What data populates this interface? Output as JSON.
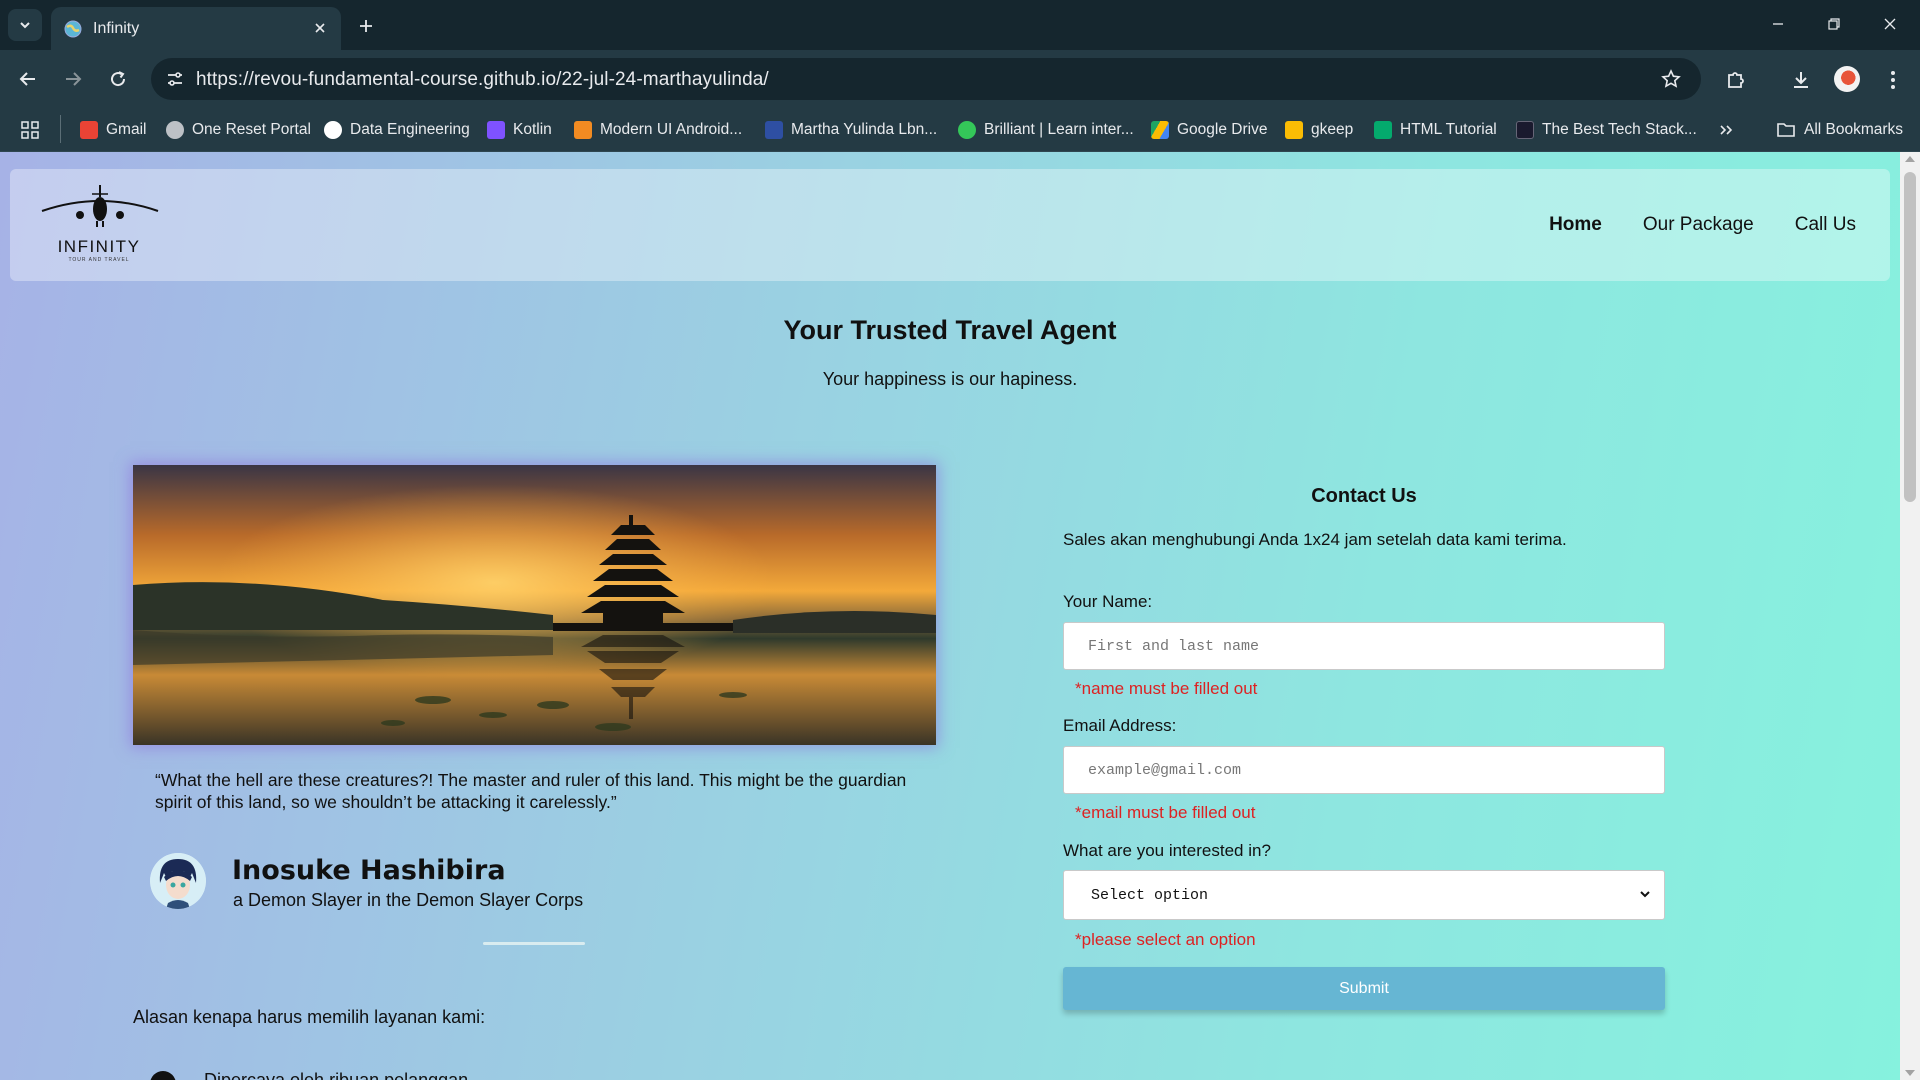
{
  "browser": {
    "tab_title": "Infinity",
    "url": "https://revou-fundamental-course.github.io/22-jul-24-marthayulinda/",
    "bookmarks": [
      {
        "label": "Gmail",
        "icon": "gmail-icon",
        "color": "#ea4335"
      },
      {
        "label": "One Reset Portal",
        "icon": "globe-icon",
        "color": "#bdc1c6"
      },
      {
        "label": "Data Engineering",
        "icon": "github-icon",
        "color": "#ffffff"
      },
      {
        "label": "Kotlin",
        "icon": "kotlin-icon",
        "color": "#7f52ff"
      },
      {
        "label": "Modern UI Android...",
        "icon": "bookmark-orange-icon",
        "color": "#f28b22"
      },
      {
        "label": "Martha Yulinda Lbn...",
        "icon": "del-icon",
        "color": "#2e4fa3"
      },
      {
        "label": "Brilliant | Learn inter...",
        "icon": "brilliant-icon",
        "color": "#34c759"
      },
      {
        "label": "Google Drive",
        "icon": "drive-icon",
        "color": "#fbbc04"
      },
      {
        "label": "gkeep",
        "icon": "keep-icon",
        "color": "#fbbc04"
      },
      {
        "label": "HTML Tutorial",
        "icon": "w3schools-icon",
        "color": "#04aa6d"
      },
      {
        "label": "The Best Tech Stack...",
        "icon": "techstack-icon",
        "color": "#1a1a2e"
      }
    ],
    "all_bookmarks_label": "All Bookmarks"
  },
  "site": {
    "logo_text": "INFINITY",
    "logo_subtext": "TOUR AND TRAVEL",
    "nav": [
      {
        "label": "Home",
        "active": true
      },
      {
        "label": "Our Package",
        "active": false
      },
      {
        "label": "Call Us",
        "active": false
      }
    ],
    "hero_title": "Your Trusted Travel Agent",
    "hero_subtitle": "Your happiness is our hapiness."
  },
  "testimonial": {
    "quote": "“What the hell are these creatures?! The master and ruler of this land. This might be the guardian spirit of this land, so we shouldn’t be attacking it carelessly.”",
    "name": "Inosuke Hashibira",
    "role": "a Demon Slayer in the Demon Slayer Corps"
  },
  "reasons": {
    "title": "Alasan kenapa harus memilih layanan kami:",
    "first_item": "Dipercaya oleh ribuan pelanggan"
  },
  "contact": {
    "title": "Contact Us",
    "description": "Sales akan menghubungi Anda 1x24 jam setelah data kami terima.",
    "name_label": "Your Name:",
    "name_placeholder": "First and last name",
    "name_error": "*name must be filled out",
    "email_label": "Email Address:",
    "email_placeholder": "example@gmail.com",
    "email_error": "*email must be filled out",
    "interest_label": "What are you interested in?",
    "interest_selected": "Select option",
    "interest_error": "*please select an option",
    "submit_label": "Submit"
  },
  "colors": {
    "error": "#dd2222",
    "submit": "#66b6d3",
    "chrome_dark": "#15262e",
    "chrome": "#243a44"
  }
}
